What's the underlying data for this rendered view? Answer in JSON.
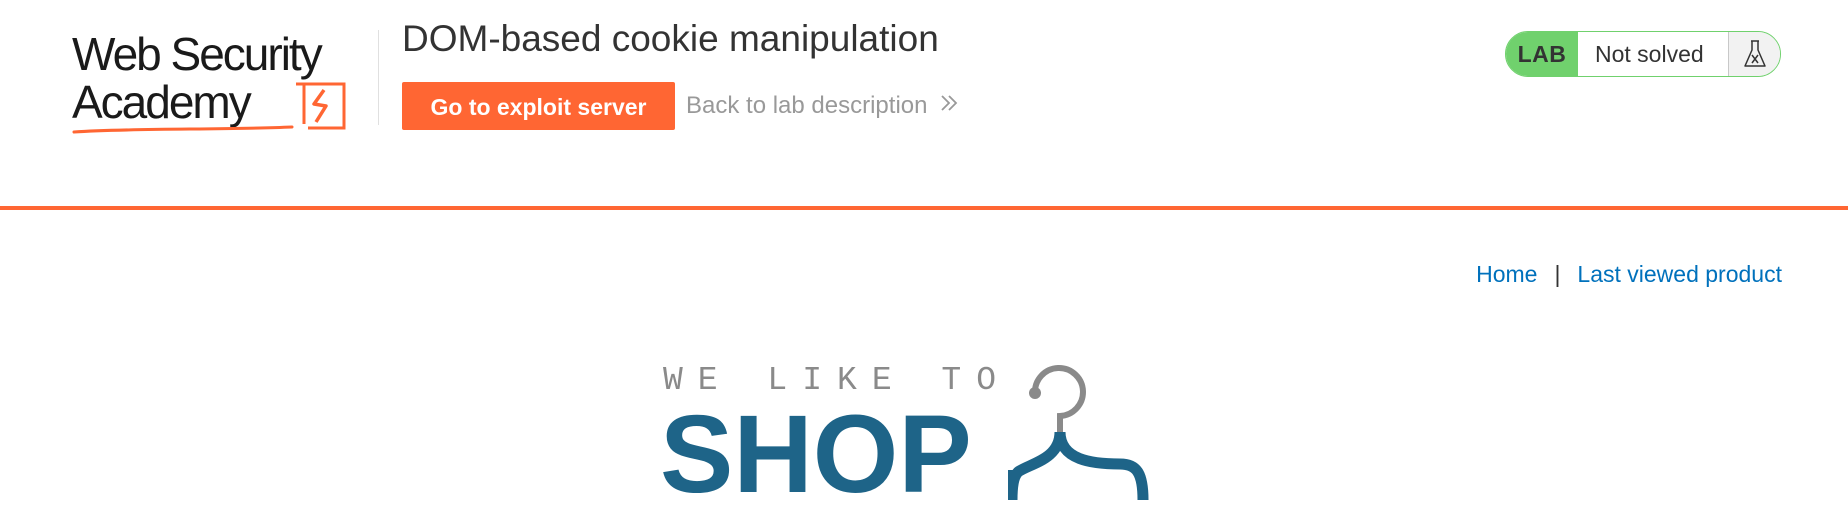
{
  "header": {
    "logo_line1": "Web Security",
    "logo_line2": "Academy",
    "title": "DOM-based cookie manipulation",
    "exploit_button_label": "Go to exploit server",
    "back_link_label": "Back to lab description",
    "lab_status": {
      "badge": "LAB",
      "status": "Not solved",
      "icon": "flask-icon"
    }
  },
  "nav": {
    "links": [
      {
        "label": "Home"
      },
      {
        "label": "Last viewed product"
      }
    ],
    "separator": "|"
  },
  "banner": {
    "tagline": "WE LIKE TO",
    "headline": "SHOP",
    "icon": "hanger-icon"
  },
  "colors": {
    "accent": "#ff6633",
    "lab_green": "#70d16d",
    "link_blue": "#0071bc",
    "shop_blue": "#1e6488",
    "muted_grey": "#999999"
  }
}
